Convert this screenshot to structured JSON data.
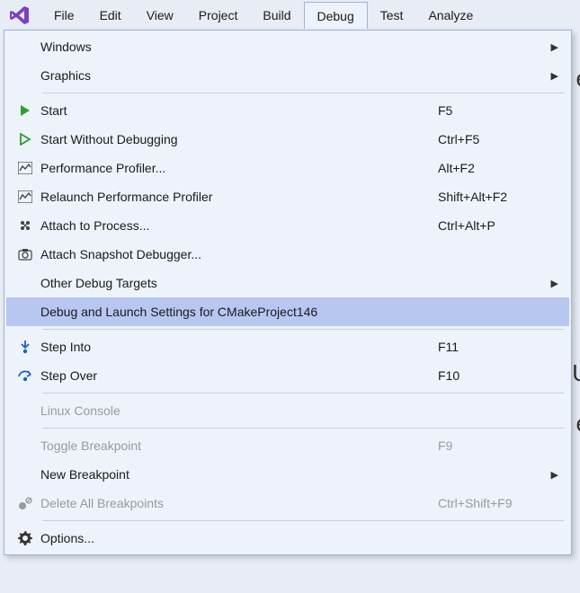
{
  "menubar": {
    "items": [
      "File",
      "Edit",
      "View",
      "Project",
      "Build",
      "Debug",
      "Test",
      "Analyze"
    ],
    "active_index": 5
  },
  "background_hints": [
    "e",
    "U",
    "e"
  ],
  "dropdown": {
    "groups": [
      [
        {
          "label": "Windows",
          "shortcut": "",
          "submenu": true,
          "icon": null,
          "disabled": false,
          "selected": false
        },
        {
          "label": "Graphics",
          "shortcut": "",
          "submenu": true,
          "icon": null,
          "disabled": false,
          "selected": false
        }
      ],
      [
        {
          "label": "Start",
          "shortcut": "F5",
          "submenu": false,
          "icon": "play-green",
          "disabled": false,
          "selected": false
        },
        {
          "label": "Start Without Debugging",
          "shortcut": "Ctrl+F5",
          "submenu": false,
          "icon": "play-outline",
          "disabled": false,
          "selected": false
        },
        {
          "label": "Performance Profiler...",
          "shortcut": "Alt+F2",
          "submenu": false,
          "icon": "profiler",
          "disabled": false,
          "selected": false
        },
        {
          "label": "Relaunch Performance Profiler",
          "shortcut": "Shift+Alt+F2",
          "submenu": false,
          "icon": "profiler",
          "disabled": false,
          "selected": false
        },
        {
          "label": "Attach to Process...",
          "shortcut": "Ctrl+Alt+P",
          "submenu": false,
          "icon": "attach",
          "disabled": false,
          "selected": false
        },
        {
          "label": "Attach Snapshot Debugger...",
          "shortcut": "",
          "submenu": false,
          "icon": "snapshot",
          "disabled": false,
          "selected": false
        },
        {
          "label": "Other Debug Targets",
          "shortcut": "",
          "submenu": true,
          "icon": null,
          "disabled": false,
          "selected": false
        },
        {
          "label": "Debug and Launch Settings for CMakeProject146",
          "shortcut": "",
          "submenu": false,
          "icon": null,
          "disabled": false,
          "selected": true
        }
      ],
      [
        {
          "label": "Step Into",
          "shortcut": "F11",
          "submenu": false,
          "icon": "step-into",
          "disabled": false,
          "selected": false
        },
        {
          "label": "Step Over",
          "shortcut": "F10",
          "submenu": false,
          "icon": "step-over",
          "disabled": false,
          "selected": false
        }
      ],
      [
        {
          "label": "Linux Console",
          "shortcut": "",
          "submenu": false,
          "icon": null,
          "disabled": true,
          "selected": false
        }
      ],
      [
        {
          "label": "Toggle Breakpoint",
          "shortcut": "F9",
          "submenu": false,
          "icon": null,
          "disabled": true,
          "selected": false
        },
        {
          "label": "New Breakpoint",
          "shortcut": "",
          "submenu": true,
          "icon": null,
          "disabled": false,
          "selected": false
        },
        {
          "label": "Delete All Breakpoints",
          "shortcut": "Ctrl+Shift+F9",
          "submenu": false,
          "icon": "delete-bp",
          "disabled": true,
          "selected": false
        }
      ],
      [
        {
          "label": "Options...",
          "shortcut": "",
          "submenu": false,
          "icon": "gear",
          "disabled": false,
          "selected": false
        }
      ]
    ]
  }
}
